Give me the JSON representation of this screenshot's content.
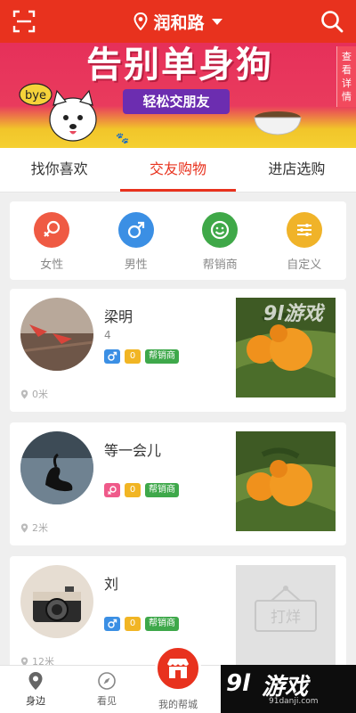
{
  "header": {
    "location": "润和路",
    "icons": [
      "scan-icon",
      "location-pin-icon",
      "search-icon"
    ]
  },
  "banner": {
    "title": "告别单身狗",
    "subtitle": "轻松交朋友",
    "dog_badge": "bye",
    "side_link": "查看详情"
  },
  "tabs": [
    {
      "label": "找你喜欢",
      "active": false
    },
    {
      "label": "交友购物",
      "active": true
    },
    {
      "label": "进店选购",
      "active": false
    }
  ],
  "categories": [
    {
      "label": "女性",
      "color": "#ef5a43",
      "icon": "female-icon"
    },
    {
      "label": "男性",
      "color": "#3b8fe4",
      "icon": "male-icon"
    },
    {
      "label": "帮销商",
      "color": "#3fa848",
      "icon": "smile-icon"
    },
    {
      "label": "自定义",
      "color": "#f0b329",
      "icon": "sliders-icon"
    }
  ],
  "users": [
    {
      "name": "梁明",
      "age": "4",
      "gender": "male",
      "level": "0",
      "tag": "帮销商",
      "distance": "0米",
      "product": "oranges"
    },
    {
      "name": "等一会儿",
      "age": "",
      "gender": "female",
      "level": "0",
      "tag": "帮销商",
      "distance": "2米",
      "product": "oranges"
    },
    {
      "name": "刘",
      "age": "",
      "gender": "male",
      "level": "0",
      "tag": "帮销商",
      "distance": "12米",
      "product": "closed",
      "product_label": "打烊"
    }
  ],
  "bottom_nav": {
    "items": [
      {
        "label": "身边",
        "icon": "location-pin-icon"
      },
      {
        "label": "看见",
        "icon": "compass-icon"
      },
      {
        "label": "我的帮城",
        "icon": "shop-icon"
      }
    ]
  },
  "watermark": {
    "logo": "9l",
    "name": "游戏",
    "url": "91danji.com",
    "overlay": "9l游戏"
  },
  "colors": {
    "primary": "#e8321e",
    "male": "#3b8fe4",
    "female": "#ef5a8a",
    "level": "#f1b524",
    "tag": "#3ea84a"
  }
}
